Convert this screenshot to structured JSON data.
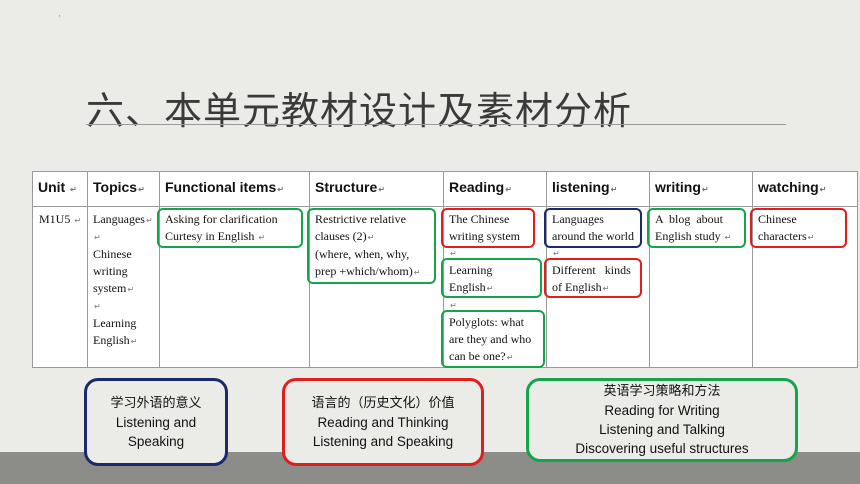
{
  "slide": {
    "corner_mark": "·",
    "title": "六、本单元教材设计及素材分析"
  },
  "table": {
    "headers": [
      "Unit",
      "Topics",
      "Functional items",
      "Structure",
      "Reading",
      "listening",
      "writing",
      "watching"
    ],
    "unit": "M1U5",
    "topics": [
      "Languages",
      "Chinese",
      "writing",
      "system",
      "Learning",
      "English"
    ],
    "functional": [
      "Asking for clarification",
      "Curtesy in English"
    ],
    "structure": [
      "Restrictive relative",
      "clauses (2)",
      "(where, when, why,",
      "prep +which/whom)"
    ],
    "reading": [
      [
        "The Chinese",
        "writing system"
      ],
      [
        "Learning",
        "English"
      ],
      [
        "Polyglots:  what",
        "are they and who",
        "can be one?"
      ]
    ],
    "listening": [
      [
        "Languages",
        "around the world"
      ],
      [
        "Different   kinds",
        "of English"
      ]
    ],
    "writing": [
      "A  blog  about",
      "English study"
    ],
    "watching": [
      "Chinese",
      "characters"
    ]
  },
  "bottom_boxes": [
    {
      "lines": [
        "学习外语的意义",
        "Listening and",
        "Speaking"
      ],
      "color": "#1a2a6c"
    },
    {
      "lines": [
        "语言的（历史文化）价值",
        "Reading and Thinking",
        "Listening and Speaking"
      ],
      "color": "#e11d1d"
    },
    {
      "lines": [
        "英语学习策略和方法",
        "Reading for Writing",
        "Listening and Talking",
        "Discovering useful structures"
      ],
      "color": "#16a34a"
    }
  ]
}
